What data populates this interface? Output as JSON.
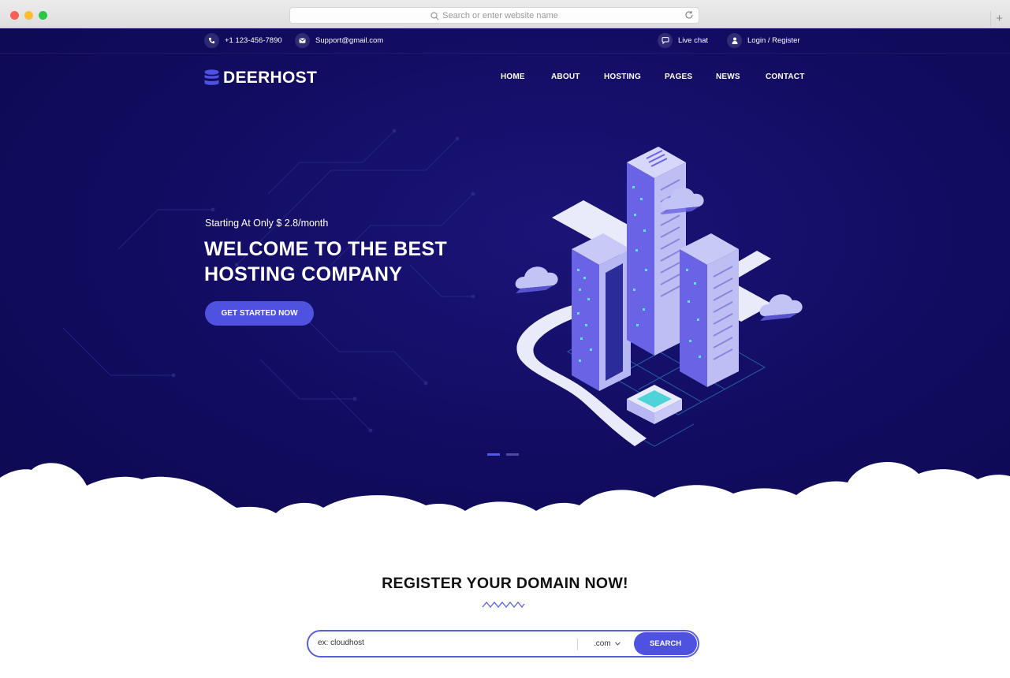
{
  "browser": {
    "url_placeholder": "Search or enter website name",
    "new_tab": "+"
  },
  "topbar": {
    "phone": "+1 123-456-7890",
    "email": "Support@gmail.com",
    "live_chat": "Live chat",
    "login": "Login / Register"
  },
  "brand": {
    "name": "DEERHOST"
  },
  "nav": {
    "items": [
      "HOME",
      "ABOUT",
      "HOSTING",
      "PAGES",
      "NEWS",
      "CONTACT"
    ],
    "active": "HOME"
  },
  "hero": {
    "subtitle": "Starting At Only $ 2.8/month",
    "title": "WELCOME TO THE BEST HOSTING COMPANY",
    "cta": "GET STARTED NOW",
    "slides": {
      "count": 2,
      "active": 1
    }
  },
  "domain": {
    "title": "REGISTER YOUR DOMAIN NOW!",
    "placeholder": "ex: cloudhost",
    "tld": ".com",
    "search_label": "SEARCH"
  },
  "colors": {
    "hero_bg": "#110c5f",
    "accent": "#4f52e0",
    "text_dark": "#111111"
  }
}
